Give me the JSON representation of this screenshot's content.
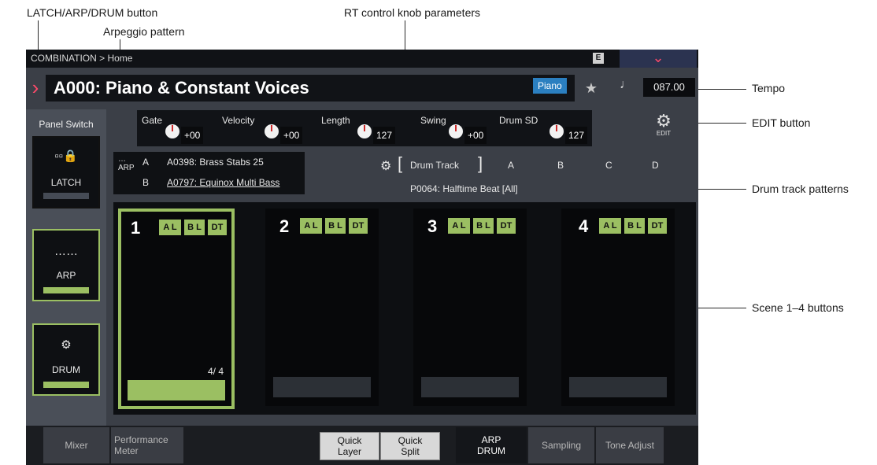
{
  "callouts": {
    "latch_arp_drum": "LATCH/ARP/DRUM button",
    "arp_pattern": "Arpeggio pattern",
    "rt_knobs": "RT control knob parameters",
    "tempo": "Tempo",
    "edit": "EDIT button",
    "drum_patterns": "Drum track patterns",
    "scenes": "Scene 1–4 buttons"
  },
  "header": {
    "breadcrumb": "COMBINATION > Home",
    "e_badge": "E",
    "program_name": "A000: Piano & Constant Voices",
    "category": "Piano",
    "tempo": "087.00"
  },
  "panel_switch": {
    "title": "Panel Switch",
    "latch": "LATCH",
    "arp": "ARP",
    "drum": "DRUM"
  },
  "rt_controls": [
    {
      "label": "Gate",
      "value": "+00"
    },
    {
      "label": "Velocity",
      "value": "+00"
    },
    {
      "label": "Length",
      "value": "127"
    },
    {
      "label": "Swing",
      "value": "+00"
    },
    {
      "label": "Drum SD",
      "value": "127"
    }
  ],
  "edit": {
    "label": "EDIT"
  },
  "arp": {
    "icon_label": "ARP",
    "a_label": "A",
    "a_pattern": "A0398: Brass Stabs 25",
    "b_label": "B",
    "b_pattern": "A0797: Equinox Multi Bass"
  },
  "drum": {
    "label": "Drum Track",
    "cols": [
      "A",
      "B",
      "C",
      "D"
    ],
    "pattern": "P0064: Halftime Beat [All]"
  },
  "scenes": [
    {
      "num": "1",
      "tags": [
        "A L",
        "B L",
        "DT"
      ],
      "count": "4/ 4",
      "selected": true
    },
    {
      "num": "2",
      "tags": [
        "A L",
        "B L",
        "DT"
      ],
      "count": "",
      "selected": false
    },
    {
      "num": "3",
      "tags": [
        "A L",
        "B L",
        "DT"
      ],
      "count": "",
      "selected": false
    },
    {
      "num": "4",
      "tags": [
        "A L",
        "B L",
        "DT"
      ],
      "count": "",
      "selected": false
    }
  ],
  "tabs": {
    "mixer": "Mixer",
    "perf1": "Performance",
    "perf2": "Meter",
    "quick_layer1": "Quick",
    "quick_layer2": "Layer",
    "quick_split1": "Quick",
    "quick_split2": "Split",
    "arpdrum1": "ARP",
    "arpdrum2": "DRUM",
    "sampling": "Sampling",
    "tone_adjust": "Tone Adjust"
  },
  "colors": {
    "accent_green": "#9bbf62",
    "accent_red": "#ff4a6a",
    "category_blue": "#2b7fc0"
  }
}
